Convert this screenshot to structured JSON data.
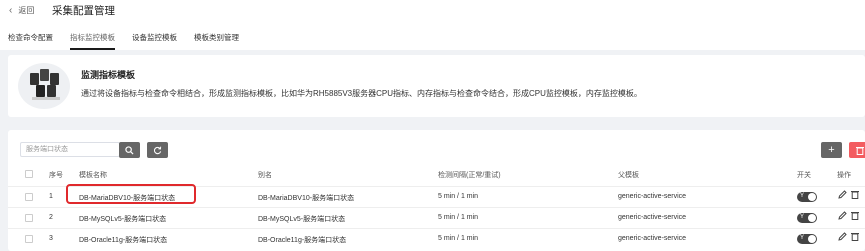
{
  "header": {
    "back_label": "返回",
    "title": "采集配置管理"
  },
  "tabs": [
    {
      "label": "检查命令配置",
      "active": false
    },
    {
      "label": "指标监控模板",
      "active": true
    },
    {
      "label": "设备监控模板",
      "active": false
    },
    {
      "label": "模板类别管理",
      "active": false
    }
  ],
  "banner": {
    "title": "监测指标模板",
    "description": "通过将设备指标与检查命令相结合，形成监测指标模板，比如华为RH5885V3服务器CPU指标、内存指标与检查命令结合，形成CPU监控模板，内存监控模板。"
  },
  "toolbar": {
    "search_placeholder": "服务端口状态"
  },
  "table": {
    "columns": [
      "序号",
      "模板名称",
      "别名",
      "检测间隔(正常/重试)",
      "父模板",
      "开关",
      "操作"
    ],
    "rows": [
      {
        "no": "1",
        "name": "DB-MariaDBV10-服务端口状态",
        "alias": "DB-MariaDBV10-服务端口状态",
        "interval": "5 min / 1 min",
        "parent": "generic-active-service",
        "switch": "Y"
      },
      {
        "no": "2",
        "name": "DB-MySQLv5-服务端口状态",
        "alias": "DB-MySQLv5-服务端口状态",
        "interval": "5 min / 1 min",
        "parent": "generic-active-service",
        "switch": "Y"
      },
      {
        "no": "3",
        "name": "DB-Oracle11g-服务端口状态",
        "alias": "DB-Oracle11g-服务端口状态",
        "interval": "5 min / 1 min",
        "parent": "generic-active-service",
        "switch": "Y"
      }
    ]
  },
  "colors": {
    "accent_dark": "#1a1a1a",
    "danger": "#f35c60",
    "highlight": "#e0292c"
  }
}
